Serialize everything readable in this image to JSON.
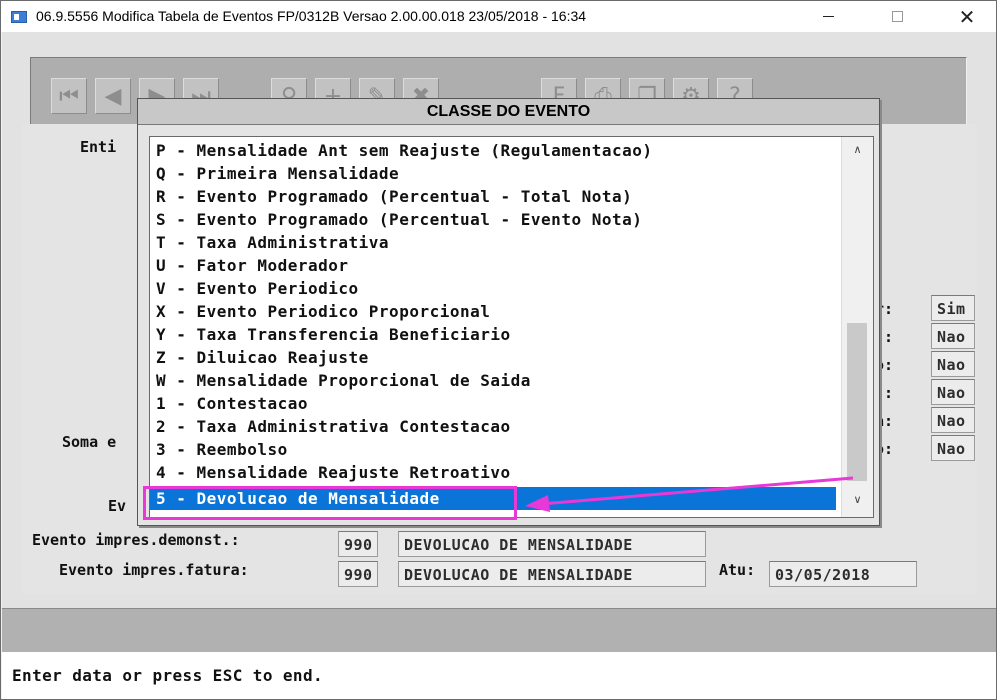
{
  "window": {
    "title": "06.9.5556  Modifica Tabela de Eventos FP/0312B Versao 2.00.00.018 23/05/2018 - 16:34",
    "close_glyph": "✕"
  },
  "toolbar": {
    "buttons": [
      {
        "name": "first-record",
        "glyph": "⏮"
      },
      {
        "name": "previous-record",
        "glyph": "◀"
      },
      {
        "name": "next-record",
        "glyph": "▶"
      },
      {
        "name": "last-record",
        "glyph": "⏭"
      },
      {
        "name": "search",
        "glyph": "⚲"
      },
      {
        "name": "add",
        "glyph": "+"
      },
      {
        "name": "edit",
        "glyph": "✎"
      },
      {
        "name": "delete",
        "glyph": "✖"
      },
      {
        "name": "filter",
        "glyph": "F"
      },
      {
        "name": "print",
        "glyph": "⎙"
      },
      {
        "name": "copy",
        "glyph": "❐"
      },
      {
        "name": "settings",
        "glyph": "⚙"
      },
      {
        "name": "help",
        "glyph": "?"
      }
    ]
  },
  "form": {
    "entidade_label": "Enti",
    "soma_label": "Soma e",
    "evento_label": "Ev",
    "right_labels": [
      "or:",
      "d.:",
      "so:",
      "t.:",
      "ta:",
      "ao:"
    ],
    "right_values": [
      "Sim",
      "Nao",
      "Nao",
      "Nao",
      "Nao",
      "Nao"
    ],
    "evento_demonst": {
      "label": "Evento impres.demonst.:",
      "code": "990",
      "desc": "DEVOLUCAO DE MENSALIDADE"
    },
    "evento_fatura": {
      "label": "Evento impres.fatura:",
      "code": "990",
      "desc": "DEVOLUCAO DE MENSALIDADE"
    },
    "atu": {
      "label": "Atu:",
      "value": "03/05/2018"
    }
  },
  "modal": {
    "title": "CLASSE DO EVENTO",
    "items": [
      "P - Mensalidade Ant sem Reajuste (Regulamentacao)",
      "Q - Primeira Mensalidade",
      "R - Evento Programado (Percentual - Total Nota)",
      "S - Evento Programado (Percentual - Evento Nota)",
      "T - Taxa Administrativa",
      "U - Fator Moderador",
      "V - Evento Periodico",
      "X - Evento Periodico Proporcional",
      "Y - Taxa Transferencia Beneficiario",
      "Z - Diluicao Reajuste",
      "W - Mensalidade Proporcional de Saida",
      "1 - Contestacao",
      "2 - Taxa Administrativa Contestacao",
      "3 - Reembolso",
      "4 - Mensalidade Reajuste Retroativo",
      "5 - Devolucao de Mensalidade"
    ],
    "selected_index": 15,
    "scroll_up_glyph": "∧",
    "scroll_down_glyph": "∨"
  },
  "status": {
    "text": "Enter data or press ESC to end."
  },
  "colors": {
    "selection": "#0a74d8",
    "annotation": "#e838d8"
  }
}
